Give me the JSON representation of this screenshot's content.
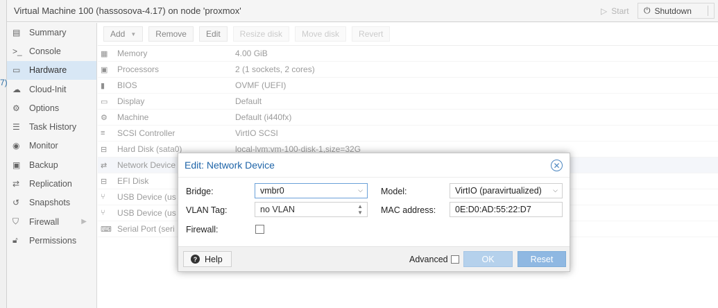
{
  "window": {
    "title": "Virtual Machine 100 (hassosova-4.17) on node 'proxmox'",
    "start_label": "Start",
    "shutdown_label": "Shutdown"
  },
  "left_fragment": "7)",
  "nav": {
    "items": [
      {
        "label": "Summary",
        "icon": "book-icon"
      },
      {
        "label": "Console",
        "icon": "terminal-icon"
      },
      {
        "label": "Hardware",
        "icon": "desktop-icon",
        "active": true
      },
      {
        "label": "Cloud-Init",
        "icon": "cloud-icon"
      },
      {
        "label": "Options",
        "icon": "gear-icon"
      },
      {
        "label": "Task History",
        "icon": "list-icon"
      },
      {
        "label": "Monitor",
        "icon": "eye-icon"
      },
      {
        "label": "Backup",
        "icon": "floppy-icon"
      },
      {
        "label": "Replication",
        "icon": "retweet-icon"
      },
      {
        "label": "Snapshots",
        "icon": "history-icon"
      },
      {
        "label": "Firewall",
        "icon": "shield-icon"
      },
      {
        "label": "Permissions",
        "icon": "unlock-icon"
      }
    ]
  },
  "toolbar": {
    "add_label": "Add",
    "remove_label": "Remove",
    "edit_label": "Edit",
    "resize_label": "Resize disk",
    "move_label": "Move disk",
    "revert_label": "Revert"
  },
  "hardware": {
    "rows": [
      {
        "key": "Memory",
        "value": "4.00 GiB",
        "icon": "memory-icon"
      },
      {
        "key": "Processors",
        "value": "2 (1 sockets, 2 cores)",
        "icon": "cpu-icon"
      },
      {
        "key": "BIOS",
        "value": "OVMF (UEFI)",
        "icon": "microchip-icon"
      },
      {
        "key": "Display",
        "value": "Default",
        "icon": "desktop-icon"
      },
      {
        "key": "Machine",
        "value": "Default (i440fx)",
        "icon": "cogs-icon"
      },
      {
        "key": "SCSI Controller",
        "value": "VirtIO SCSI",
        "icon": "database-icon"
      },
      {
        "key": "Hard Disk (sata0)",
        "value": "local-lvm:vm-100-disk-1,size=32G",
        "icon": "hdd-icon"
      },
      {
        "key": "Network Device",
        "value": "",
        "icon": "exchange-icon"
      },
      {
        "key": "EFI Disk",
        "value": "",
        "icon": "hdd-icon"
      },
      {
        "key": "USB Device (us",
        "value": "",
        "icon": "usb-icon"
      },
      {
        "key": "USB Device (us",
        "value": "",
        "icon": "usb-icon"
      },
      {
        "key": "Serial Port (seri",
        "value": "",
        "icon": "keyboard-icon"
      }
    ]
  },
  "dialog": {
    "title": "Edit: Network Device",
    "bridge_label": "Bridge:",
    "bridge_value": "vmbr0",
    "vlan_label": "VLAN Tag:",
    "vlan_value": "no VLAN",
    "firewall_label": "Firewall:",
    "firewall_checked": false,
    "model_label": "Model:",
    "model_value": "VirtIO (paravirtualized)",
    "mac_label": "MAC address:",
    "mac_value": "0E:D0:AD:55:22:D7",
    "help_label": "Help",
    "advanced_label": "Advanced",
    "advanced_checked": false,
    "ok_label": "OK",
    "reset_label": "Reset"
  },
  "colors": {
    "accent": "#1e64a8",
    "nav_active": "#d8e7f5",
    "ok_button": "#b5d1ec",
    "reset_button": "#8fb8e2"
  }
}
